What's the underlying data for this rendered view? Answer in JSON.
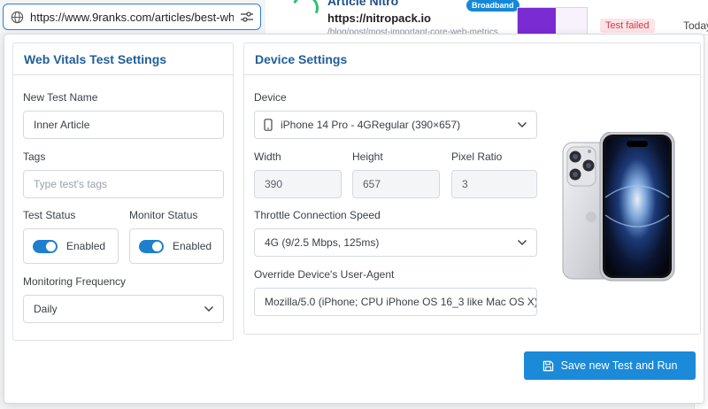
{
  "background": {
    "card_title": "Article Nitro",
    "card_site": "https://nitropack.io",
    "card_url_faint": "/blog/post/most-important-core-web-metrics",
    "badge": "Broadband",
    "status": "Test failed",
    "date": "Today"
  },
  "urlbar": {
    "url": "https://www.9ranks.com/articles/best-whi"
  },
  "web_vitals": {
    "heading": "Web Vitals Test Settings",
    "test_name_label": "New Test Name",
    "test_name_value": "Inner Article",
    "tags_label": "Tags",
    "tags_placeholder": "Type test's tags",
    "test_status_label": "Test Status",
    "test_status_value": "Enabled",
    "monitor_status_label": "Monitor Status",
    "monitor_status_value": "Enabled",
    "frequency_label": "Monitoring Frequency",
    "frequency_value": "Daily"
  },
  "device_settings": {
    "heading": "Device Settings",
    "device_label": "Device",
    "device_value": "iPhone 14 Pro - 4GRegular (390×657)",
    "width_label": "Width",
    "width_value": "390",
    "height_label": "Height",
    "height_value": "657",
    "pixel_ratio_label": "Pixel Ratio",
    "pixel_ratio_value": "3",
    "throttle_label": "Throttle Connection Speed",
    "throttle_value": "4G (9/2.5 Mbps, 125ms)",
    "ua_label": "Override Device's User-Agent",
    "ua_value": "Mozilla/5.0 (iPhone; CPU iPhone OS 16_3 like Mac OS X) ."
  },
  "actions": {
    "run_label": "Save new Test and Run"
  },
  "colors": {
    "accent": "#1b8ad8",
    "heading": "#1f5f99",
    "toggle_on": "#1f7fcf"
  }
}
